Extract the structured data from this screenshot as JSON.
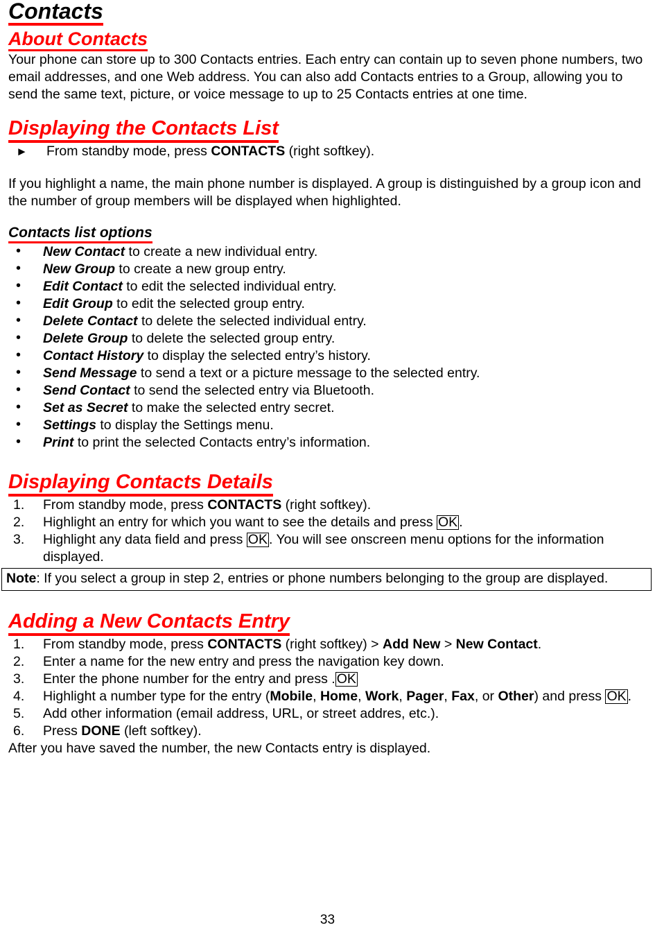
{
  "document": {
    "title": "Contacts",
    "page_number": "33",
    "accent_color": "#FF0000",
    "text_color": "#000000"
  },
  "sections": {
    "about": {
      "heading": "About Contacts",
      "paragraph": "Your phone can store up to 300 Contacts entries. Each entry can contain up to seven phone numbers, two email addresses, and one Web address. You can also add Contacts entries to a Group, allowing you to send the same text, picture, or voice message to up to 25 Contacts entries at one time."
    },
    "displaying_list": {
      "heading": "Displaying the Contacts List",
      "step_marker": "►",
      "step_pre": "From standby mode, press ",
      "step_bold": "CONTACTS",
      "step_post": " (right softkey).",
      "paragraph": "If you highlight a name, the main phone number is displayed. A group is distinguished by a group icon and the number of group members will be displayed when highlighted."
    },
    "list_options": {
      "heading": "Contacts list options",
      "bullet_glyph": "•",
      "items": [
        {
          "term": "New Contact",
          "rest": " to create a new individual entry."
        },
        {
          "term": "New Group",
          "rest": " to create a new group entry."
        },
        {
          "term": "Edit Contact",
          "rest": " to edit the selected individual entry."
        },
        {
          "term": "Edit Group",
          "rest": " to edit the selected group entry."
        },
        {
          "term": "Delete Contact",
          "rest": " to delete the selected individual entry."
        },
        {
          "term": "Delete Group",
          "rest": " to delete the selected group entry."
        },
        {
          "term": "Contact History",
          "rest": " to display the selected entry’s history."
        },
        {
          "term": "Send Message",
          "rest": " to send a text or a picture message to the selected entry."
        },
        {
          "term": "Send Contact",
          "rest": " to send the selected entry via Bluetooth."
        },
        {
          "term": "Set as Secret",
          "rest": " to make the selected entry secret."
        },
        {
          "term": "Settings",
          "rest": " to display the Settings menu."
        },
        {
          "term": "Print",
          "rest": " to print the selected Contacts entry’s information."
        }
      ]
    },
    "displaying_details": {
      "heading": "Displaying Contacts Details",
      "steps": [
        {
          "number": "1.",
          "pre": "From standby mode, press ",
          "bold": "CONTACTS",
          "post": " (right softkey)."
        },
        {
          "number": "2.",
          "pre": "Highlight an entry for which you want to see the details and press ",
          "key": "OK",
          "post": "."
        },
        {
          "number": "3.",
          "pre": "Highlight any data field and press ",
          "key": "OK",
          "post": ". You will see onscreen menu options for the information displayed."
        }
      ],
      "note": {
        "label": "Note",
        "text": ": If you select a group in step 2, entries or phone numbers belonging to the group are displayed."
      }
    },
    "adding_entry": {
      "heading": "Adding a New Contacts Entry",
      "steps": [
        {
          "number": "1.",
          "p1": "From standby mode, press ",
          "b1": "CONTACTS",
          "p2": " (right softkey) > ",
          "b2": "Add New",
          "p3": " > ",
          "b3": "New Contact",
          "p4": "."
        },
        {
          "number": "2.",
          "p1": "Enter a name for the new entry and press the navigation key down."
        },
        {
          "number": "3.",
          "p1": "Enter the phone number for the entry and press ",
          "key": "OK",
          "p2": "."
        },
        {
          "number": "4.",
          "p1": "Highlight a number type for the entry (",
          "types": [
            "Mobile",
            "Home",
            "Work",
            "Pager",
            "Fax"
          ],
          "p2": ", or ",
          "b_other": "Other",
          "p3": ") and press ",
          "key": "OK",
          "p4": "."
        },
        {
          "number": "5.",
          "p1": "Add other information (email address, URL, or street addres, etc.)."
        },
        {
          "number": "6.",
          "p1": "Press ",
          "b1": "DONE",
          "p2": " (left softkey)."
        }
      ],
      "closing": "After you have saved the number, the new Contacts entry is displayed."
    }
  }
}
